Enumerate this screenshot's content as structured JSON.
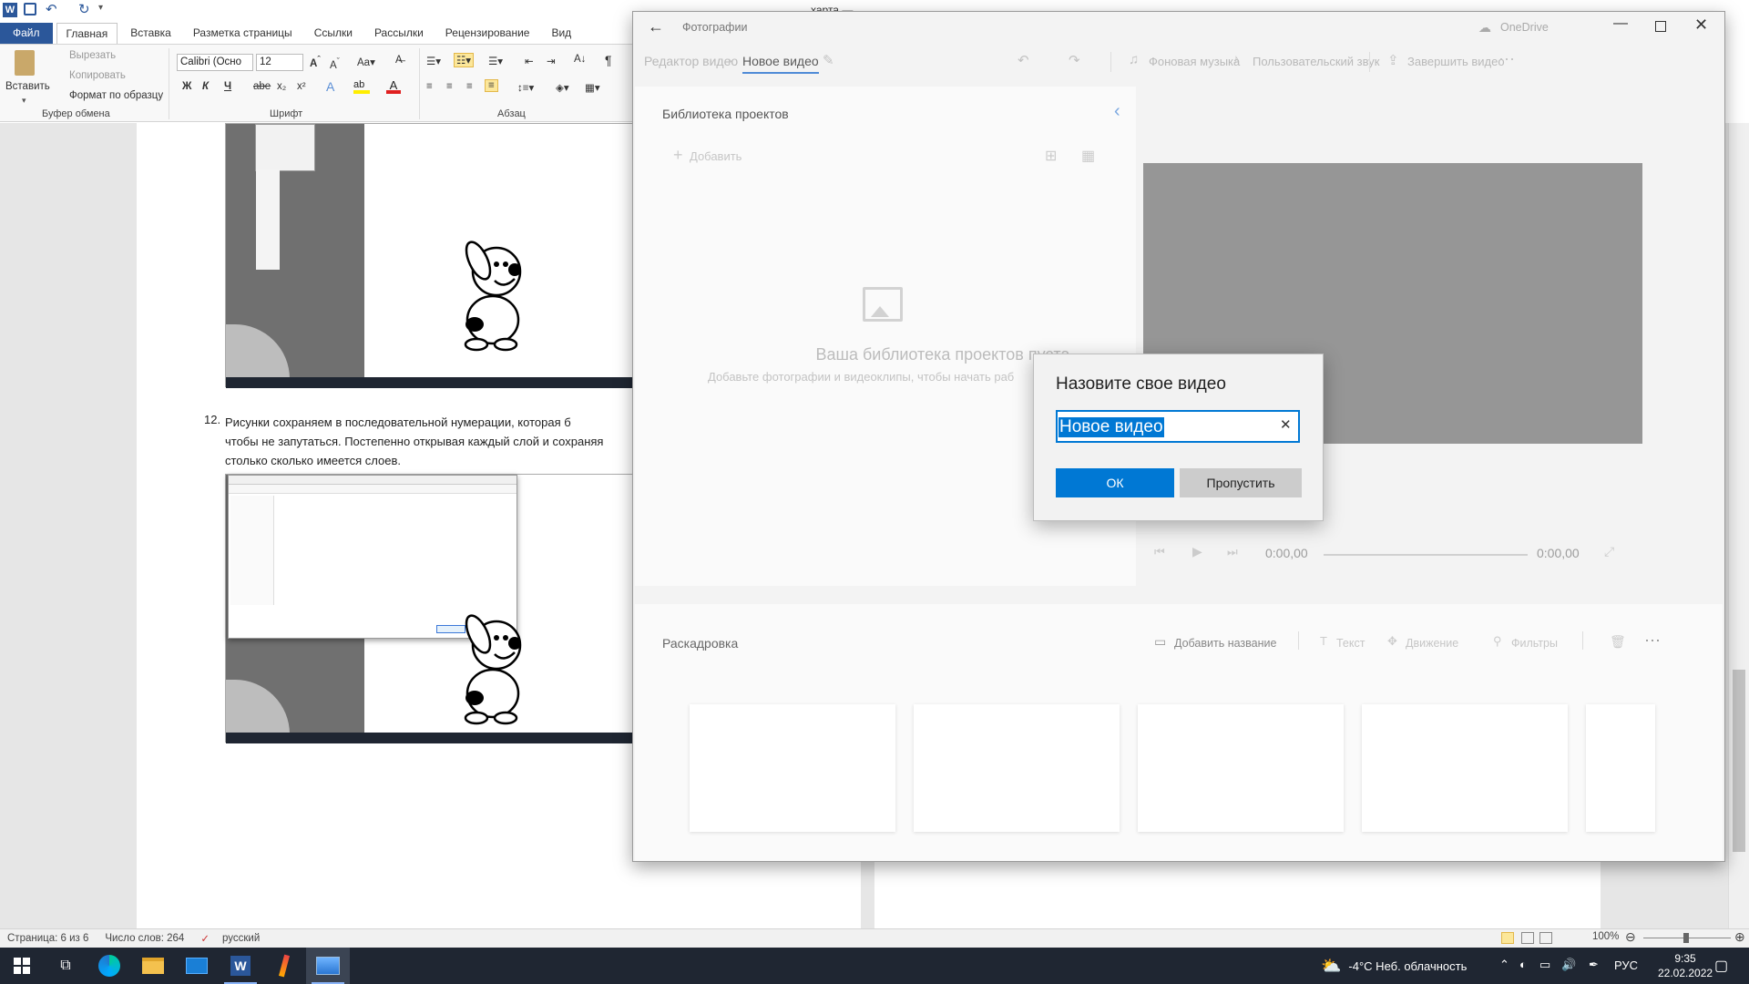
{
  "word": {
    "title": "харта — Microsoft Word",
    "tabs": [
      "Файл",
      "Главная",
      "Вставка",
      "Разметка страницы",
      "Ссылки",
      "Рассылки",
      "Рецензирование",
      "Вид"
    ],
    "clipboard": {
      "paste": "Вставить",
      "cut": "Вырезать",
      "copy": "Копировать",
      "format_painter": "Формат по образцу",
      "group": "Буфер обмена"
    },
    "font": {
      "name": "Calibri (Осно",
      "size": "12",
      "group": "Шрифт"
    },
    "paragraph": {
      "group": "Абзац"
    },
    "doc": {
      "item_number": "12.",
      "paragraph_lines": [
        "Рисунки  сохраняем  в  последовательной  нумерации,  которая  б",
        "чтобы не запутаться. Постепенно открывая каждый слой и сохраняя",
        "столько сколько имеется слоев."
      ]
    },
    "status": {
      "page": "Страница: 6 из 6",
      "words": "Число слов: 264",
      "language": "русский",
      "zoom": "100%"
    }
  },
  "photos": {
    "app_name": "Фотографии",
    "onedrive": "OneDrive",
    "breadcrumb": [
      "Редактор видео",
      "Новое видео"
    ],
    "toolbar": {
      "background_music": "Фоновая музыка",
      "custom_audio": "Пользовательский звук",
      "finish_video": "Завершить видео"
    },
    "library": {
      "title": "Библиотека проектов",
      "add": "Добавить",
      "empty_title": "Ваша библиотека проектов пуста",
      "empty_subtitle": "Добавьте фотографии и видеоклипы, чтобы начать раб"
    },
    "player": {
      "time_current": "0:00,00",
      "time_total": "0:00,00"
    },
    "storyboard": {
      "title": "Раскадровка",
      "add_title": "Добавить название",
      "text": "Текст",
      "motion": "Движение",
      "filters": "Фильтры"
    }
  },
  "dialog": {
    "title": "Назовите свое видео",
    "input_value": "Новое видео",
    "ok": "ОК",
    "skip": "Пропустить"
  },
  "taskbar": {
    "weather": "-4°C  Неб. облачность",
    "language": "РУС",
    "time": "9:35",
    "date": "22.02.2022"
  },
  "colors": {
    "word_blue": "#2b579a",
    "accent": "#0078d4",
    "taskbar": "#1f2632"
  }
}
